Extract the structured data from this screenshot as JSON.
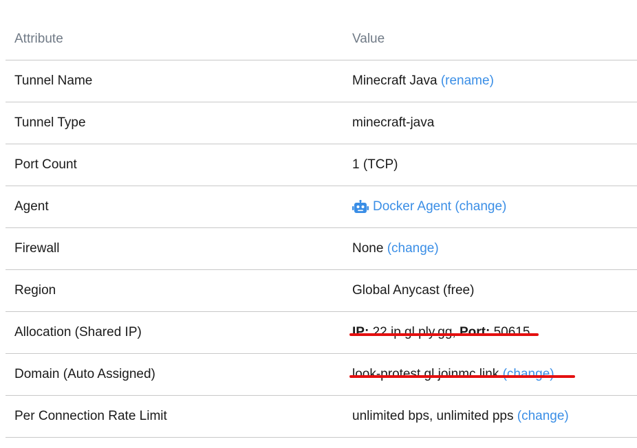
{
  "header": {
    "attribute_label": "Attribute",
    "value_label": "Value"
  },
  "rows": {
    "tunnel_name": {
      "label": "Tunnel Name",
      "value": "Minecraft Java",
      "action": "(rename)"
    },
    "tunnel_type": {
      "label": "Tunnel Type",
      "value": "minecraft-java"
    },
    "port_count": {
      "label": "Port Count",
      "value": "1 (TCP)"
    },
    "agent": {
      "label": "Agent",
      "value": "Docker Agent",
      "action": "(change)",
      "icon": "robot-icon"
    },
    "firewall": {
      "label": "Firewall",
      "value": "None",
      "action": "(change)"
    },
    "region": {
      "label": "Region",
      "value": "Global Anycast (free)"
    },
    "allocation": {
      "label": "Allocation (Shared IP)",
      "ip_label": "IP:",
      "ip_value": "22.ip.gl.ply.gg,",
      "port_label": "Port:",
      "port_value": "50615"
    },
    "domain": {
      "label": "Domain (Auto Assigned)",
      "value": "look-protest.gl.joinmc.link",
      "action": "(change)"
    },
    "rate_limit": {
      "label": "Per Connection Rate Limit",
      "value": "unlimited bps, unlimited pps",
      "action": "(change)"
    }
  },
  "colors": {
    "link": "#3a8ee6",
    "header_text": "#707a86",
    "annotation_underline": "#e41010",
    "divider": "#c8c8c8"
  }
}
